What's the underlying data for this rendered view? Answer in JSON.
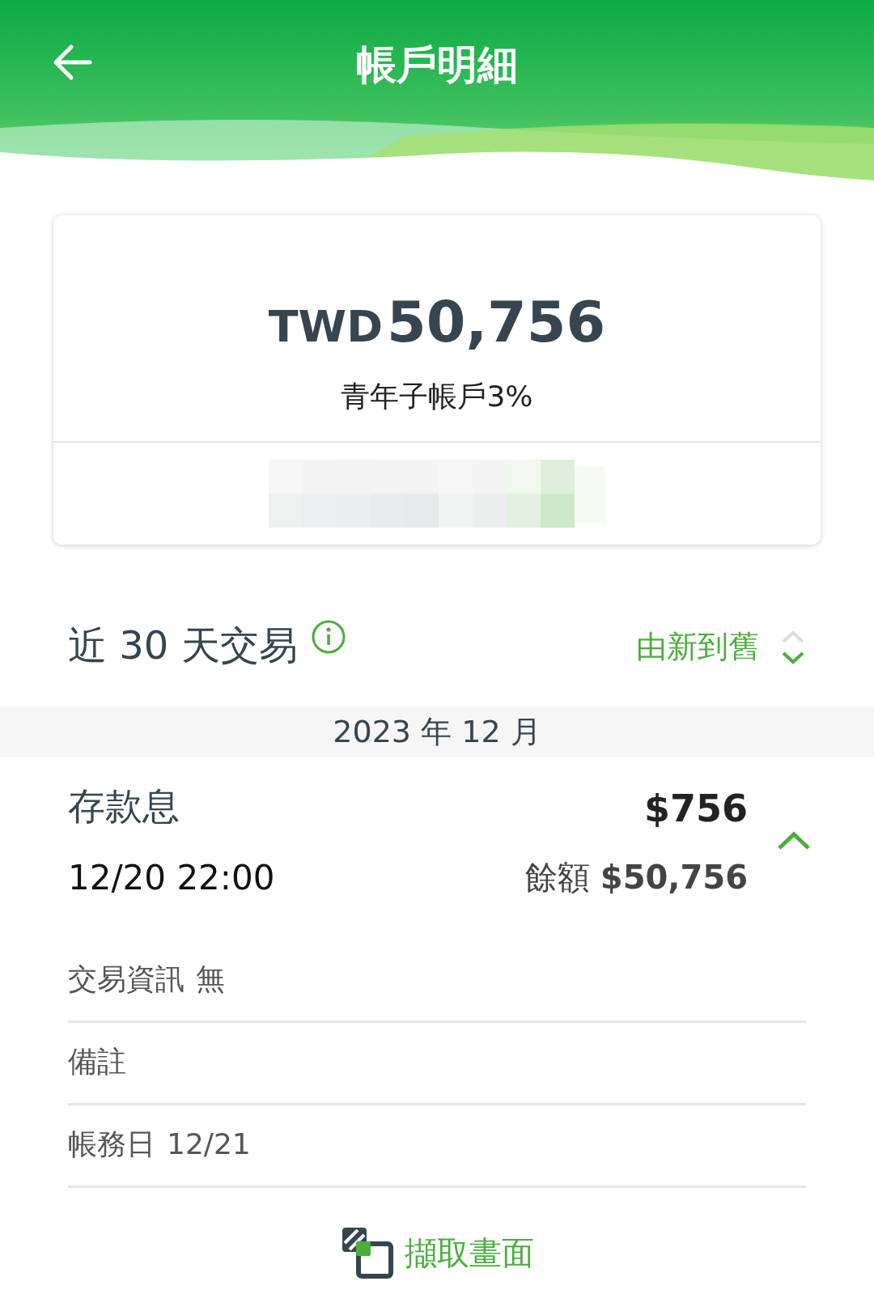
{
  "header": {
    "title": "帳戶明細"
  },
  "account": {
    "currency": "TWD",
    "balance": "50,756",
    "name": "青年子帳戶3%"
  },
  "transactions_header": {
    "title": "近 30 天交易",
    "sort": "由新到舊"
  },
  "month": "2023 年 12 月",
  "transactions": [
    {
      "title": "存款息",
      "time": "12/20 22:00",
      "amount": "$756",
      "balance_label": "餘額",
      "balance": "$50,756",
      "expanded": true,
      "details": [
        {
          "label": "交易資訊",
          "value": "無"
        },
        {
          "label": "備註"
        },
        {
          "label": "帳務日",
          "value": "12/21"
        }
      ]
    }
  ],
  "capture_button": {
    "label": "擷取畫面"
  }
}
